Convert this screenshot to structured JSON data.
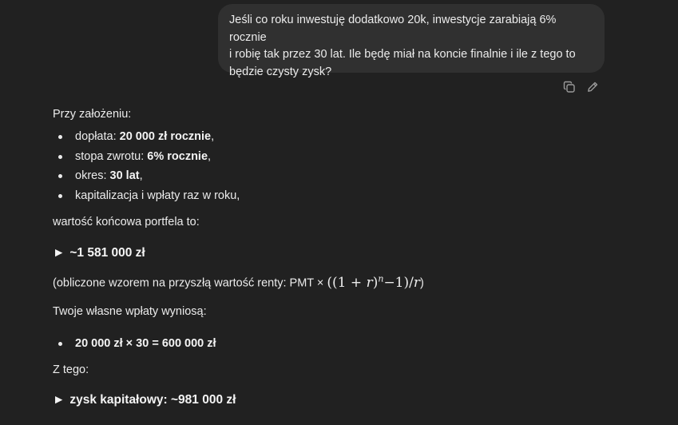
{
  "user_message": {
    "line1": "Jeśli co roku inwestuję dodatkowo 20k, inwestycje zarabiają 6% rocznie",
    "line2": "i robię tak przez 30 lat. Ile będę miał na koncie finalnie i ile z tego to",
    "line3": "będzie czysty zysk?"
  },
  "actions": {
    "copy_icon": "copy-icon",
    "edit_icon": "pencil-icon"
  },
  "assistant": {
    "intro": "Przy założeniu:",
    "bullets": [
      {
        "prefix": "dopłata: ",
        "bold": "20 000 zł rocznie",
        "suffix": ","
      },
      {
        "prefix": "stopa zwrotu: ",
        "bold": "6% rocznie",
        "suffix": ","
      },
      {
        "prefix": "okres: ",
        "bold": "30 lat",
        "suffix": ","
      },
      {
        "prefix": "kapitalizacja i wpłaty raz w roku,",
        "bold": "",
        "suffix": ""
      }
    ],
    "final_value_text": "wartość końcowa portfela to:",
    "result1_arrow": "►",
    "result1": "~1 581 000 zł",
    "formula_prefix": "(obliczone wzorem na przyszłą wartość renty: PMT × ",
    "formula_suffix": ")",
    "own_payments": "Twoje własne wpłaty wyniosą:",
    "own_bullet": "20 000 zł × 30 = 600 000 zł",
    "ztego": "Z tego:",
    "result2_arrow": "►",
    "result2": "zysk kapitałowy: ~981 000 zł"
  }
}
